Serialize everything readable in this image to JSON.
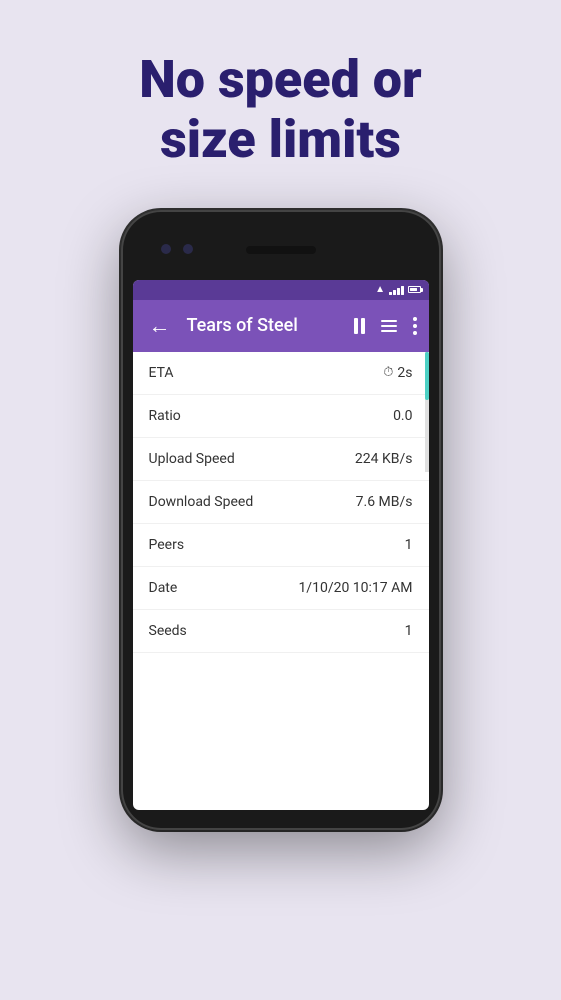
{
  "headline": {
    "line1": "No speed or",
    "line2": "size limits"
  },
  "phone": {
    "app": {
      "toolbar": {
        "title": "Tears of Steel",
        "back_icon": "←",
        "back_label": "Back"
      },
      "rows": [
        {
          "label": "ETA",
          "value": "2s",
          "has_icon": true
        },
        {
          "label": "Ratio",
          "value": "0.0",
          "has_icon": false
        },
        {
          "label": "Upload Speed",
          "value": "224 KB/s",
          "has_icon": false
        },
        {
          "label": "Download Speed",
          "value": "7.6 MB/s",
          "has_icon": false
        },
        {
          "label": "Peers",
          "value": "1",
          "has_icon": false
        },
        {
          "label": "Date",
          "value": "1/10/20 10:17 AM",
          "has_icon": false
        },
        {
          "label": "Seeds",
          "value": "1",
          "has_icon": false
        }
      ]
    }
  }
}
